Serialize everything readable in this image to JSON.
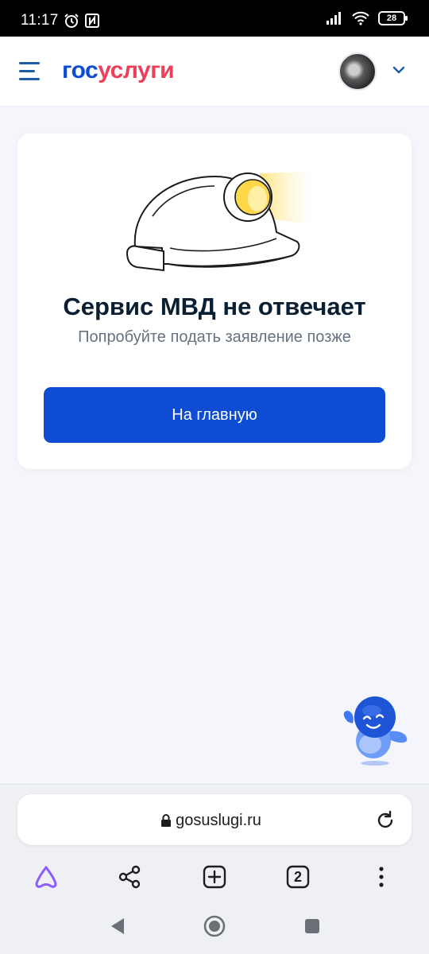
{
  "status_bar": {
    "time": "11:17",
    "battery": "28",
    "icons": [
      "alarm-icon",
      "nfc-icon",
      "signal-icon",
      "wifi-icon",
      "battery-icon"
    ]
  },
  "header": {
    "logo_part1": "гос",
    "logo_part2": "услуги",
    "icons": [
      "menu-icon",
      "avatar",
      "chevron-down-icon"
    ]
  },
  "error_card": {
    "title": "Сервис МВД не отвечает",
    "subtitle": "Попробуйте подать заявление позже",
    "button_label": "На главную",
    "illustration": "miner-helmet-illustration"
  },
  "assistant": {
    "icon": "robot-assistant-icon"
  },
  "browser": {
    "url": "gosuslugi.ru",
    "tab_count": "2",
    "icons": [
      "lock-icon",
      "reload-icon",
      "alice-icon",
      "share-icon",
      "new-tab-icon",
      "tabs-icon",
      "more-icon"
    ]
  },
  "system_nav": {
    "icons": [
      "back-icon",
      "home-icon",
      "recents-icon"
    ]
  },
  "colors": {
    "brand_blue": "#0d4cd3",
    "brand_red": "#ee3f58",
    "text_dark": "#0b1f33",
    "text_muted": "#66727f",
    "page_bg": "#f4f6fb",
    "alice_purple": "#8c5cff"
  }
}
